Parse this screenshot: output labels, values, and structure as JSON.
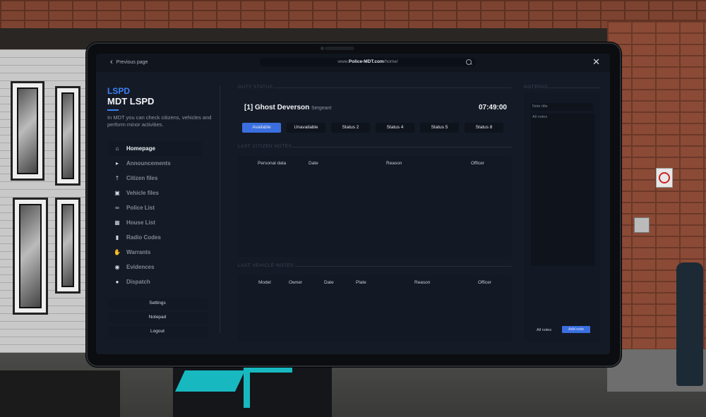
{
  "browser": {
    "back_label": "Previous page",
    "url_prefix": "www.",
    "url_domain": "Police-MDT.com",
    "url_path": "/home/"
  },
  "brand": {
    "org": "LSPD",
    "title": "MDT LSPD",
    "description": "In MDT you can check citizens, vehicles and perform minor activities."
  },
  "nav": [
    {
      "label": "Homepage",
      "icon": "home-icon",
      "active": true
    },
    {
      "label": "Announcements",
      "icon": "megaphone-icon",
      "active": false
    },
    {
      "label": "Citizen files",
      "icon": "person-icon",
      "active": false
    },
    {
      "label": "Vehicle files",
      "icon": "car-icon",
      "active": false
    },
    {
      "label": "Police List",
      "icon": "glasses-icon",
      "active": false
    },
    {
      "label": "House List",
      "icon": "house-icon",
      "active": false
    },
    {
      "label": "Radio Codes",
      "icon": "radio-icon",
      "active": false
    },
    {
      "label": "Warrants",
      "icon": "hand-icon",
      "active": false
    },
    {
      "label": "Evidences",
      "icon": "camera-icon",
      "active": false
    },
    {
      "label": "Dispatch",
      "icon": "info-icon",
      "active": false
    }
  ],
  "side_buttons": {
    "settings": "Settings",
    "notepad": "Notepad",
    "logout": "Logout"
  },
  "duty": {
    "heading": "DUTY STATUS",
    "officer_name": "[1] Ghost Deverson",
    "officer_rank": "Sergeant",
    "time": "07:49:00",
    "statuses": [
      {
        "label": "Available",
        "active": true
      },
      {
        "label": "Unavailable",
        "active": false
      },
      {
        "label": "Status 2",
        "active": false
      },
      {
        "label": "Status 4",
        "active": false
      },
      {
        "label": "Status 5",
        "active": false
      },
      {
        "label": "Status 8",
        "active": false
      }
    ]
  },
  "citizen_notes": {
    "heading": "LAST CITIZEN NOTES",
    "columns": [
      "Personal data",
      "Date",
      "Reason",
      "Officer"
    ]
  },
  "vehicle_notes": {
    "heading": "LAST VEHICLE NOTES",
    "columns": [
      "Model",
      "Owner",
      "Date",
      "Plate",
      "Reason",
      "Officer"
    ]
  },
  "notepad": {
    "heading": "NOTEPAD",
    "title_placeholder": "Note title",
    "body_placeholder": "All notes",
    "all_notes_label": "All notes",
    "add_label": "Add note"
  },
  "colors": {
    "accent": "#3b6fe0",
    "brand": "#3b82f6",
    "screen_bg": "#151b26",
    "panel_bg": "#121824"
  }
}
